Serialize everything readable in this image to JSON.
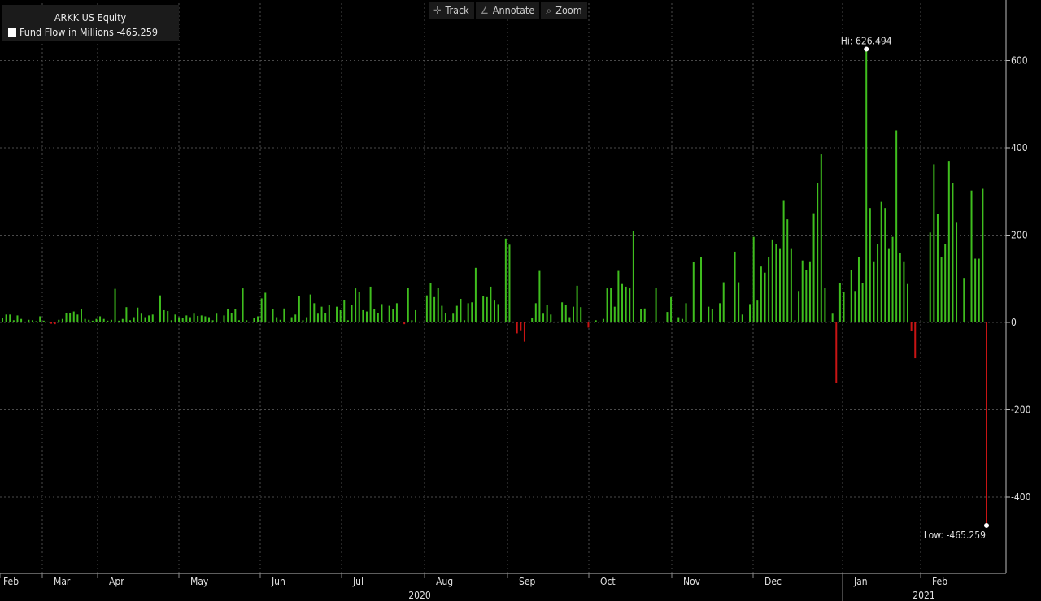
{
  "legend": {
    "title": "ARKK US Equity",
    "series_text": "Fund Flow in Millions -465.259"
  },
  "toolbar": [
    {
      "label": "Track",
      "icon": "crosshair-icon"
    },
    {
      "label": "Annotate",
      "icon": "pencil-icon"
    },
    {
      "label": "Zoom",
      "icon": "magnifier-icon"
    }
  ],
  "colors": {
    "background": "#000000",
    "positive": "#3fbe1e",
    "negative": "#c81414",
    "grid": "#4a4a4a"
  },
  "chart_data": {
    "type": "bar",
    "title": "ARKK US Equity",
    "series_name": "Fund Flow in Millions",
    "ylim": [
      -520,
      730
    ],
    "yticks": [
      -400,
      -200,
      0,
      200,
      400,
      600
    ],
    "grid": true,
    "y_axis_position": "right",
    "legend_position": "top-left",
    "month_labels": [
      "Feb",
      "Mar",
      "Apr",
      "May",
      "Jun",
      "Jul",
      "Aug",
      "Sep",
      "Oct",
      "Nov",
      "Dec",
      "Jan",
      "Feb"
    ],
    "year_labels": [
      "2020",
      "2021"
    ],
    "annotations": {
      "high": "Hi: 626.494",
      "low": "Low: -465.259"
    },
    "values": [
      10,
      18,
      18,
      5,
      16,
      8,
      2,
      6,
      5,
      3,
      14,
      4,
      2,
      -3,
      -4,
      6,
      8,
      22,
      22,
      25,
      18,
      30,
      8,
      6,
      4,
      8,
      14,
      8,
      4,
      6,
      77,
      4,
      8,
      35,
      5,
      12,
      34,
      20,
      12,
      16,
      18,
      2,
      62,
      28,
      26,
      5,
      18,
      12,
      10,
      16,
      12,
      20,
      15,
      16,
      14,
      12,
      5,
      20,
      2,
      16,
      30,
      22,
      30,
      5,
      78,
      5,
      2,
      10,
      14,
      55,
      68,
      2,
      30,
      12,
      6,
      32,
      2,
      12,
      18,
      60,
      5,
      12,
      64,
      44,
      20,
      36,
      22,
      40,
      2,
      36,
      28,
      52,
      5,
      40,
      78,
      70,
      28,
      25,
      82,
      30,
      22,
      42,
      2,
      38,
      30,
      44,
      2,
      -4,
      80,
      5,
      28,
      2,
      2,
      62,
      90,
      58,
      80,
      38,
      22,
      5,
      20,
      38,
      54,
      5,
      44,
      46,
      125,
      2,
      60,
      58,
      82,
      50,
      42,
      2,
      192,
      178,
      2,
      -25,
      -18,
      -44,
      2,
      10,
      44,
      118,
      20,
      40,
      18,
      2,
      2,
      46,
      40,
      12,
      36,
      84,
      35,
      2,
      -12,
      2,
      5,
      2,
      8,
      78,
      80,
      36,
      118,
      88,
      82,
      78,
      210,
      2,
      30,
      32,
      2,
      2,
      80,
      2,
      2,
      24,
      58,
      2,
      12,
      8,
      44,
      2,
      138,
      2,
      150,
      2,
      36,
      30,
      2,
      44,
      92,
      2,
      2,
      162,
      92,
      18,
      2,
      42,
      196,
      50,
      128,
      114,
      150,
      190,
      180,
      170,
      280,
      236,
      170,
      5,
      72,
      142,
      120,
      140,
      250,
      320,
      385,
      80,
      2,
      20,
      -138,
      90,
      70,
      2,
      120,
      72,
      150,
      90,
      626,
      262,
      140,
      180,
      276,
      262,
      170,
      196,
      440,
      160,
      140,
      88,
      -20,
      -82,
      2,
      2,
      2,
      206,
      362,
      248,
      150,
      180,
      370,
      320,
      230,
      2,
      102,
      2,
      302,
      146,
      146,
      306,
      -465
    ]
  }
}
